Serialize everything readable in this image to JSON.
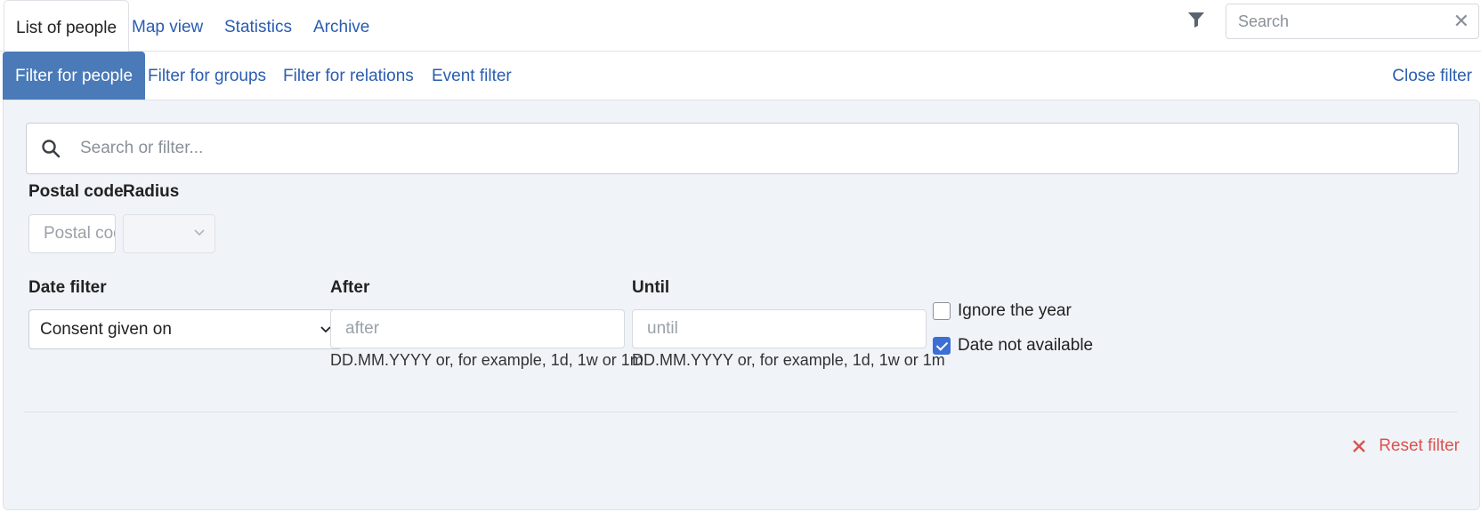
{
  "tabs": [
    "List of people",
    "Map view",
    "Statistics",
    "Archive"
  ],
  "header": {
    "filter_icon": "filter-icon",
    "search_placeholder": "Search",
    "clear_glyph": "✕"
  },
  "filter_nav": {
    "items": [
      "Filter for people",
      "Filter for groups",
      "Filter for relations",
      "Event filter"
    ],
    "close_label": "Close filter"
  },
  "panel": {
    "search_placeholder": "Search or filter...",
    "postal_code_label": "Postal code",
    "postal_code_placeholder": "Postal code",
    "radius_label": "Radius",
    "radius_value": "",
    "date_filter_label": "Date filter",
    "date_filter_value": "Consent given on",
    "after_label": "After",
    "after_placeholder": "after",
    "after_hint": "DD.MM.YYYY or, for example, 1d, 1w or 1m",
    "until_label": "Until",
    "until_placeholder": "until",
    "until_hint": "DD.MM.YYYY or, for example, 1d, 1w or 1m",
    "ignore_year_label": "Ignore the year",
    "ignore_year_checked": false,
    "date_na_label": "Date not available",
    "date_na_checked": true,
    "reset_label": "Reset filter"
  },
  "colors": {
    "accent": "#2a5db0",
    "active_tab_bg": "#4a7ab8",
    "panel_bg": "#f0f4f9",
    "reset_red": "#d9534f",
    "checkbox_blue": "#3b6fd6"
  }
}
